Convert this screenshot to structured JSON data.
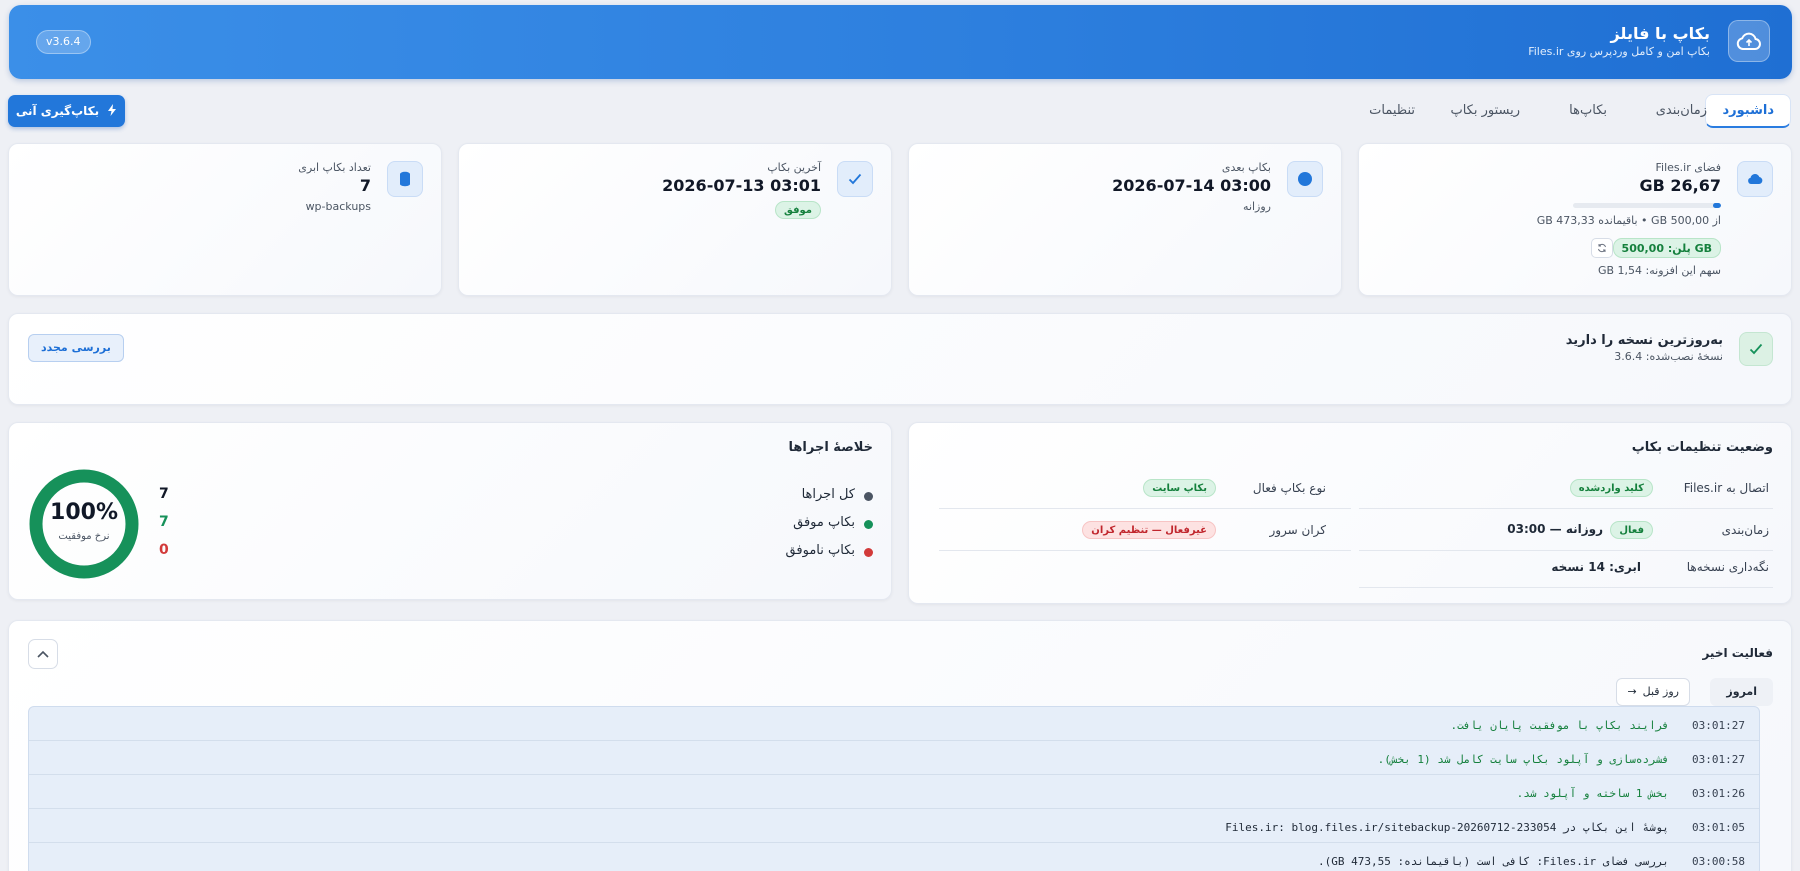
{
  "header": {
    "title": "بکاپ با فایلز",
    "subtitle": "بکاپ امن و کامل وردپرس روی Files.ir",
    "version": "v3.6.4"
  },
  "tabs": [
    {
      "label": "داشبورد",
      "active": true
    },
    {
      "label": "زمان‌بندی"
    },
    {
      "label": "بکاپ‌ها"
    },
    {
      "label": "ریستور بکاپ"
    },
    {
      "label": "تنظیمات"
    }
  ],
  "instant_backup_label": "بکاپ‌گیری آنی",
  "stats": {
    "quota": {
      "label": "فضای Files.ir",
      "value": "26,67 GB",
      "detail": "از 500,00 GB • باقیمانده 473,33 GB",
      "used_fraction": 0.0533,
      "plan": "پلن: 500,00 GB",
      "plugin_share": "سهم این افزونه: 1,54 GB"
    },
    "next_backup": {
      "label": "بکاپ بعدی",
      "value": "2026-07-14 03:00",
      "sub": "روزانه"
    },
    "last_backup": {
      "label": "آخرین بکاپ",
      "value": "2026-07-13 03:01",
      "status": "موفق"
    },
    "cloud_count": {
      "label": "تعداد بکاپ ابری",
      "value": "7",
      "sub": "wp-backups"
    }
  },
  "update": {
    "title": "به‌روزترین نسخه را دارید",
    "installed": "نسخهٔ نصب‌شده: 3.6.4",
    "recheck_label": "بررسی مجدد"
  },
  "settings_status": {
    "title": "وضعیت تنظیمات بکاپ",
    "connection_label": "اتصال به Files.ir",
    "connection_value": "کلید واردشده",
    "schedule_label": "زمان‌بندی",
    "schedule_active": "فعال",
    "schedule_value": "روزانه — 03:00",
    "retention_label": "نگه‌داری نسخه‌ها",
    "retention_value": "ابری: 14 نسخه",
    "backup_type_label": "نوع بکاپ فعال",
    "backup_type_value": "بکاپ سایت",
    "cron_label": "کران سرور",
    "cron_value": "غیرفعال — تنظیم کران"
  },
  "summary": {
    "title": "خلاصهٔ اجراها",
    "items": [
      {
        "label": "کل اجراها",
        "value": "7",
        "color": "#4b5563"
      },
      {
        "label": "بکاپ موفق",
        "value": "7",
        "color": "#16915a"
      },
      {
        "label": "بکاپ ناموفق",
        "value": "0",
        "color": "#d23a3a"
      }
    ],
    "success_rate": "100%",
    "success_rate_value": 1.0,
    "success_rate_label": "نرخ موفقیت"
  },
  "activity": {
    "title": "فعالیت اخیر",
    "today_label": "امروز",
    "prev_day_label": "روز قبل",
    "logs": [
      {
        "time": "03:01:27",
        "msg": "فرایند بکاپ با موفقیت پایان یافت.",
        "color": "#15803d"
      },
      {
        "time": "03:01:27",
        "msg": "فشرده‌سازی و آپلود بکاپ سایت کامل شد (1 بخش).",
        "color": "#15803d"
      },
      {
        "time": "03:01:26",
        "msg": "بخش 1 ساخته و آپلود شد.",
        "color": "#15803d"
      },
      {
        "time": "03:01:05",
        "msg": "پوشهٔ این بکاپ در Files.ir: blog.files.ir/sitebackup-20260712-233054",
        "color": "#1f2937"
      },
      {
        "time": "03:00:58",
        "msg": "بررسی فضای Files.ir: کافی است (باقیمانده: 473,55 GB).",
        "color": "#1f2937"
      }
    ]
  },
  "colors": {
    "accent": "#2277da",
    "success": "#16915a",
    "danger": "#d23a3a"
  }
}
